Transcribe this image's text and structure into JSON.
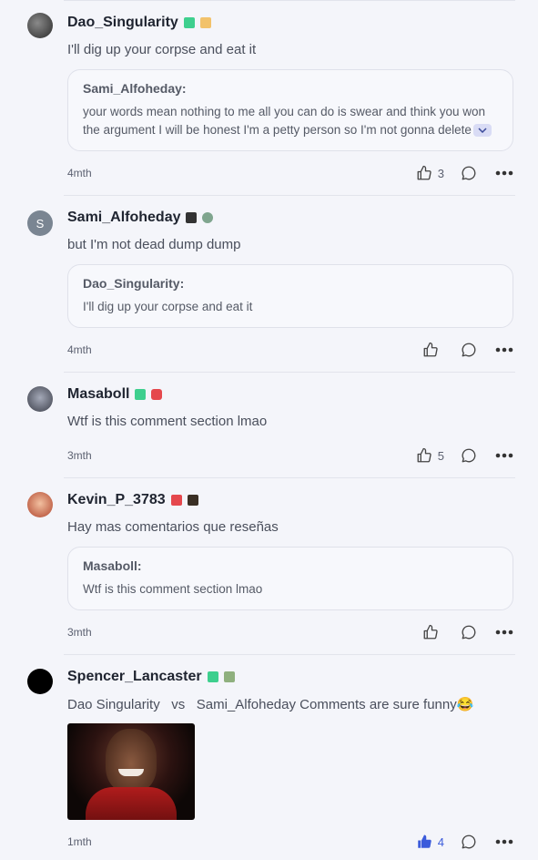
{
  "comments": [
    {
      "author": "Dao_Singularity",
      "text": "I'll dig up your corpse and eat it",
      "quote": {
        "author": "Sami_Alfoheday:",
        "text": "your words mean nothing to me all you can do is swear and think you won the argument I will be honest I'm a petty person so I'm not gonna delete"
      },
      "time": "4mth",
      "likes": "3"
    },
    {
      "author": "Sami_Alfoheday",
      "avatar_letter": "S",
      "text": "but I'm not dead dump dump",
      "quote": {
        "author": "Dao_Singularity:",
        "text": "I'll dig up your corpse and eat it"
      },
      "time": "4mth",
      "likes": ""
    },
    {
      "author": "Masaboll",
      "text": "Wtf is this comment section lmao",
      "time": "3mth",
      "likes": "5"
    },
    {
      "author": "Kevin_P_3783",
      "text": "Hay mas comentarios que reseñas",
      "quote": {
        "author": "Masaboll:",
        "text": "Wtf is this comment section lmao"
      },
      "time": "3mth",
      "likes": ""
    },
    {
      "author": "Spencer_Lancaster",
      "text_part1": "Dao Singularity",
      "text_part2": "vs",
      "text_part3": "Sami_Alfoheday Comments are sure funny",
      "emoji": "😂",
      "time": "1mth",
      "likes": "4",
      "liked": true
    }
  ],
  "colors": {
    "accent": "#3b5bdb",
    "badge_green": "#3ecf8e",
    "badge_red": "#e5484d",
    "badge_dark": "#333333"
  }
}
